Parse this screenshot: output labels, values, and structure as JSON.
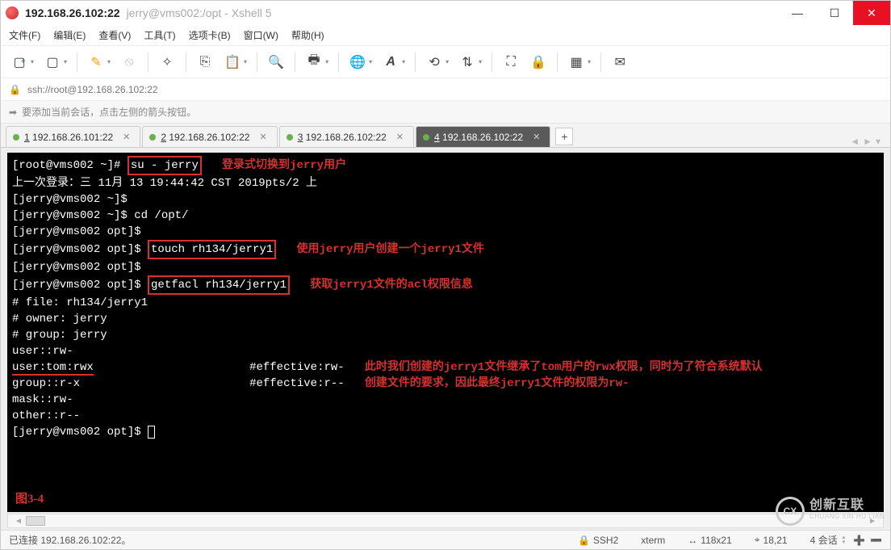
{
  "titlebar": {
    "main": "192.168.26.102:22",
    "sub": "jerry@vms002:/opt - Xshell 5"
  },
  "menu": {
    "file": "文件(F)",
    "edit": "编辑(E)",
    "view": "查看(V)",
    "tools": "工具(T)",
    "tabs": "选项卡(B)",
    "window": "窗口(W)",
    "help": "帮助(H)"
  },
  "addressbar": {
    "url": "ssh://root@192.168.26.102:22"
  },
  "hintbar": {
    "text": "要添加当前会话，点击左侧的箭头按钮。"
  },
  "tabs": {
    "items": [
      {
        "label": "1 192.168.26.101:22",
        "active": false
      },
      {
        "label": "2 192.168.26.102:22",
        "active": false
      },
      {
        "label": "3 192.168.26.102:22",
        "active": false
      },
      {
        "label": "4 192.168.26.102:22",
        "active": true
      }
    ]
  },
  "terminal": {
    "l1_prompt": "[root@vms002 ~]# ",
    "l1_cmd": "su - jerry",
    "ann1": "登录式切换到jerry用户",
    "l2": "上一次登录：三 11月 13 19:44:42 CST 2019pts/2 上",
    "l3": "[jerry@vms002 ~]$",
    "l4": "[jerry@vms002 ~]$ cd /opt/",
    "l5": "[jerry@vms002 opt]$",
    "l6_prompt": "[jerry@vms002 opt]$ ",
    "l6_cmd": "touch rh134/jerry1",
    "ann2": "使用jerry用户创建一个jerry1文件",
    "l7": "[jerry@vms002 opt]$",
    "l8_prompt": "[jerry@vms002 opt]$ ",
    "l8_cmd": "getfacl rh134/jerry1",
    "ann3": "获取jerry1文件的acl权限信息",
    "l9": "# file: rh134/jerry1",
    "l10": "# owner: jerry",
    "l11": "# group: jerry",
    "l12": "user::rw-",
    "l13": "user:tom:rwx",
    "l13_eff": "#effective:rw-",
    "ann4a": "此时我们创建的jerry1文件继承了tom用户的rwx权限，同时为了符合系统默认",
    "l14": "group::r-x",
    "l14_eff": "#effective:r--",
    "ann4b": "创建文件的要求，因此最终jerry1文件的权限为rw-",
    "l15": "mask::rw-",
    "l16": "other::r--",
    "l17": "",
    "l18": "[jerry@vms002 opt]$ ",
    "figure": "图3-4"
  },
  "status": {
    "connected": "已连接 192.168.26.102:22。",
    "ssh": "SSH2",
    "term": "xterm",
    "size": "118x21",
    "pos": "18,21",
    "sessions": "4 会话"
  },
  "watermark": {
    "cn": "创新互联",
    "en": "CHUANG XIN HU LIAN"
  }
}
